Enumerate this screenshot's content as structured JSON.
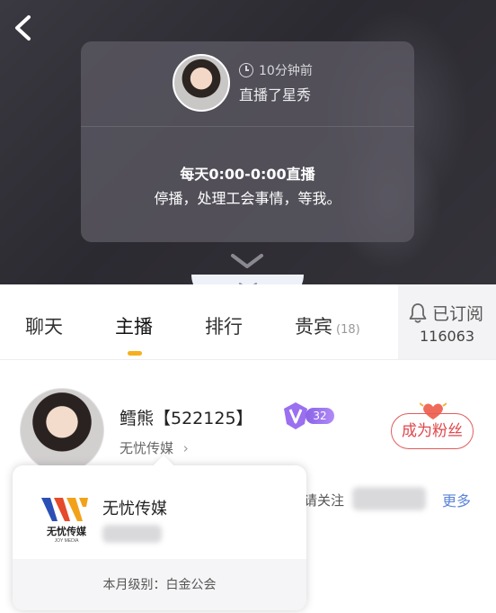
{
  "hero": {
    "back_icon": "chevron-left-icon",
    "notice": {
      "time": "10分钟前",
      "action": "直播了星秀",
      "schedule": "每天0:00-0:00直播",
      "message": "停播，处理工会事情，等我。"
    }
  },
  "tabs": [
    {
      "label": "聊天"
    },
    {
      "label": "主播"
    },
    {
      "label": "排行"
    },
    {
      "label": "贵宾",
      "count": "(18)"
    }
  ],
  "active_tab_index": 1,
  "subscribe": {
    "label": "已订阅",
    "count": "116063",
    "icon": "bell-icon"
  },
  "anchor": {
    "name": "鳕熊【522125】",
    "level": "32",
    "agency_link": "无忧传媒",
    "fan_button": "成为粉丝"
  },
  "follow": {
    "prompt": "请关注",
    "more": "更多"
  },
  "guild_popup": {
    "logo_text": "无忧传媒",
    "logo_subtext": "JOY MEDIA",
    "name": "无忧传媒",
    "level": "本月级别：白金公会"
  },
  "colors": {
    "accent_yellow": "#f5b01c",
    "fan_red": "#e0484d",
    "link_blue": "#5d84d8",
    "level_purple": "#8a63e8"
  }
}
